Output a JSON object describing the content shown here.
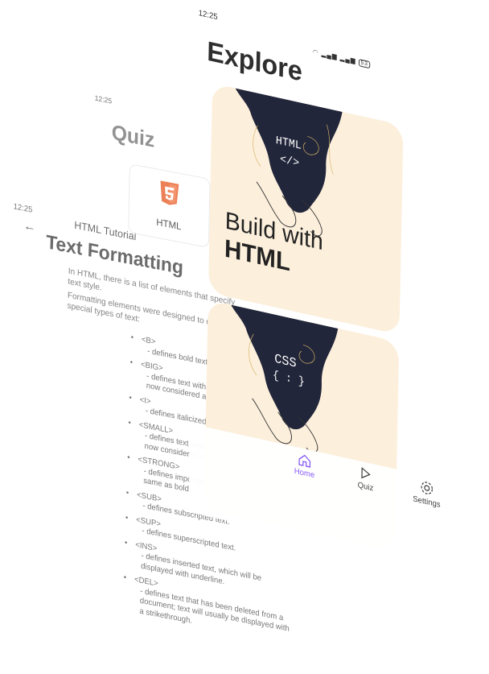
{
  "tutorial": {
    "time": "12:25",
    "back_icon": "arrow-left-icon",
    "breadcrumb": "HTML Tutorial",
    "title": "Text Formatting",
    "intro": "In HTML, there is a list of elements that specify text style.",
    "intro2": "Formatting elements were designed to display special types of text:",
    "items": [
      {
        "tag": "<B>",
        "desc": "- defines bold text."
      },
      {
        "tag": "<BIG>",
        "desc": "- defines text with a bigger font. This tag is now considered an obsolete element."
      },
      {
        "tag": "<I>",
        "desc": "- defines italicized text."
      },
      {
        "tag": "<SMALL>",
        "desc": "- defines text with a smaller font. This tag is now considered obsolete."
      },
      {
        "tag": "<STRONG>",
        "desc": "- defines important text, displayed almost the same as bold."
      },
      {
        "tag": "<SUB>",
        "desc": "- defines subscripted text."
      },
      {
        "tag": "<SUP>",
        "desc": "- defines superscripted text."
      },
      {
        "tag": "<INS>",
        "desc": "- defines inserted text, which will be displayed with underline."
      },
      {
        "tag": "<DEL>",
        "desc": "- defines text that has been deleted from a document; text will usually be displayed with a strikethrough."
      }
    ]
  },
  "quiz": {
    "time": "12:25",
    "title": "Quiz",
    "card_label": "HTML",
    "card_icon": "html5-logo-icon",
    "nav_home": "Home",
    "nav_quiz": "Quiz"
  },
  "explore": {
    "time": "12:25",
    "battery": "53",
    "title": "Explore",
    "card1": {
      "code_label": "HTML",
      "code_symbol": "</>",
      "caption_line1": "Build with",
      "caption_line2": "HTML"
    },
    "card2": {
      "code_label": "CSS",
      "code_symbol": "{ : }"
    },
    "nav": [
      {
        "label": "Home",
        "icon": "home-icon"
      },
      {
        "label": "Quiz",
        "icon": "quiz-icon"
      },
      {
        "label": "Settings",
        "icon": "settings-icon"
      }
    ],
    "accent": "#8a5cf6",
    "card_bg": "#fcefdc"
  }
}
